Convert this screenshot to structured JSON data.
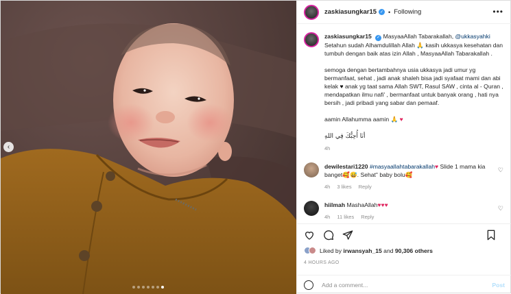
{
  "colors": {
    "accent": "#0095f6",
    "link": "#00376b",
    "muted": "#8e8e8e",
    "heart": "#e0245e"
  },
  "header": {
    "username": "zaskiasungkar15",
    "separator": "•",
    "follow_status": "Following",
    "more_icon": "more-icon"
  },
  "caption": {
    "username": "zaskiasungkar15",
    "line1": "MasyaaAllah Tabarakallah,",
    "mention": "@ukkasyahki",
    "text1": "Setahun sudah Alhamdulillah Allah 🙏 kasih ukkasya kesehatan dan tumbuh dengan baik atas izin Allah , MasyaaAllah Tabarakallah .",
    "text2a": "semoga dengan bertambahnya usia ukkasya jadi umur yg bermanfaat, sehat , jadi anak shaleh bisa jadi syafaat mami dan abi kelak",
    "text2b": "anak yg taat sama Allah SWT, Rasul SAW , cinta al - Quran , mendapatkan ilmu nafi' , bermanfaat untuk banyak orang , hati nya bersih , jadi pribadi yang sabar dan pemaaf.",
    "text3": "aamin Allahumma aamin",
    "arabic": "أنَا أُحِبُّكَ فِي اللهِ",
    "time": "4h"
  },
  "comments": [
    {
      "username": "dewilestari1220",
      "hashtag": "#masyaallahtabarakallah",
      "text": "Slide 1 mama kia banget🥰😅. Sehat\" baby bolu🥰",
      "time": "4h",
      "likes": "3 likes",
      "reply": "Reply"
    },
    {
      "username": "hiilmah",
      "text": "MashaAllah",
      "hearts": "♥♥♥",
      "time": "4h",
      "likes": "11 likes",
      "reply": "Reply"
    }
  ],
  "likes": {
    "prefix": "Liked by",
    "user": "irwansyah_15",
    "and": "and",
    "count": "90,306 others"
  },
  "timestamp": "4 HOURS AGO",
  "add_comment": {
    "placeholder": "Add a comment...",
    "post_label": "Post"
  },
  "carousel": {
    "slide_count": 7,
    "active_index": 6
  }
}
